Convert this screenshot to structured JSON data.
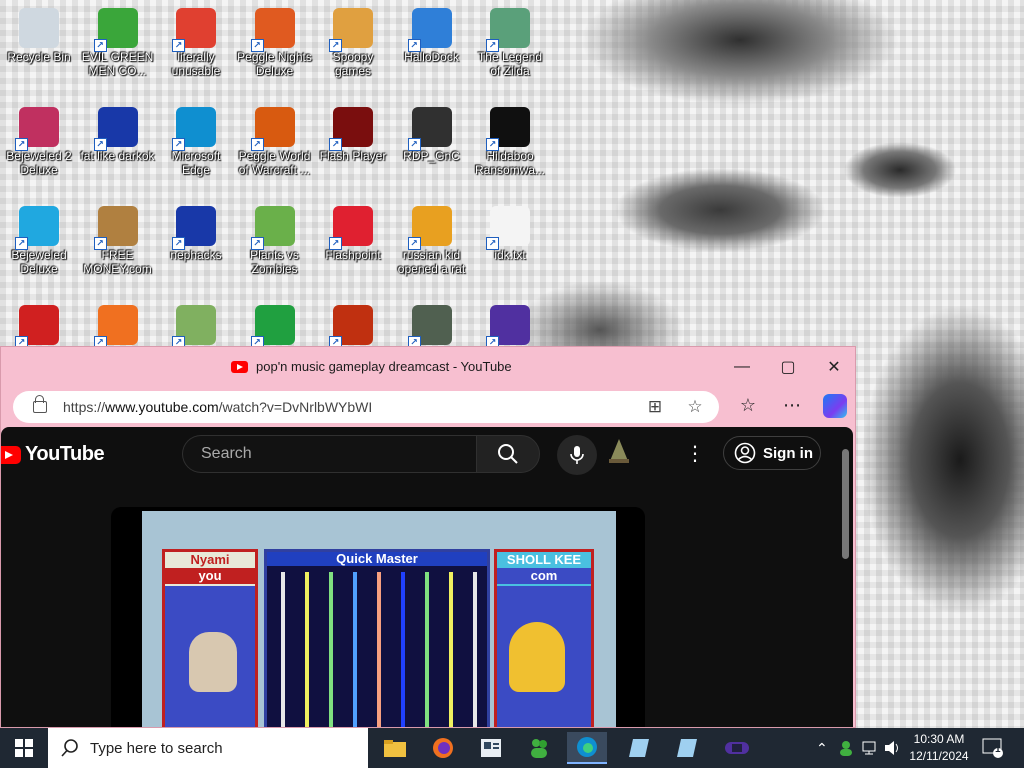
{
  "desktop": {
    "icons": [
      {
        "label": "Recycle Bin",
        "icon": "recycle-bin-icon",
        "color": "#cfd8e0"
      },
      {
        "label": "EVIL GREEN\nMEN CO...",
        "icon": "green-men-icon",
        "color": "#3aa63a"
      },
      {
        "label": "literally\nunusable",
        "icon": "chrome-icon",
        "color": "#e04030"
      },
      {
        "label": "Peggle Nights\nDeluxe",
        "icon": "peggle-icon",
        "color": "#e05a20"
      },
      {
        "label": "Spoopy\ngames",
        "icon": "folder-icon",
        "color": "#e0a040"
      },
      {
        "label": "HalloDock",
        "icon": "shield-icon",
        "color": "#2f7fd8"
      },
      {
        "label": "The Legend\nof Zilda",
        "icon": "zilda-icon",
        "color": "#5aa07a"
      },
      {
        "label": "Bejeweled 2\nDeluxe",
        "icon": "bejeweled-icon",
        "color": "#c03060"
      },
      {
        "label": "fat like darkok",
        "icon": "mpi-icon",
        "color": "#1838a8"
      },
      {
        "label": "Microsoft\nEdge",
        "icon": "edge-icon",
        "color": "#0f8fd0"
      },
      {
        "label": "Peggle World\nof Warcraft ...",
        "icon": "peggle-icon",
        "color": "#d85a10"
      },
      {
        "label": "Flash Player",
        "icon": "flash-icon",
        "color": "#7a0e0e"
      },
      {
        "label": "RDP_GnC",
        "icon": "rdp-icon",
        "color": "#303030"
      },
      {
        "label": "Hildaboo\nRansomwa...",
        "icon": "yashma-icon",
        "color": "#101010"
      },
      {
        "label": "Bejeweled\nDeluxe",
        "icon": "gem-icon",
        "color": "#20a8e0"
      },
      {
        "label": "FREE\nMONEY.com",
        "icon": "money-bag-icon",
        "color": "#b08040"
      },
      {
        "label": "nephacks",
        "icon": "mpi-icon",
        "color": "#1838a8"
      },
      {
        "label": "Plants vs\nZombies",
        "icon": "plant-icon",
        "color": "#6ab04a"
      },
      {
        "label": "Flashpoint",
        "icon": "flashpoint-icon",
        "color": "#e02030"
      },
      {
        "label": "russian kid\nopened a rat",
        "icon": "de-icon",
        "color": "#e8a020"
      },
      {
        "label": "idk.txt",
        "icon": "text-file-icon",
        "color": "#f4f4f4"
      },
      {
        "label": "",
        "icon": "red-fuzzy-icon",
        "color": "#d02020"
      },
      {
        "label": "",
        "icon": "firefox-icon",
        "color": "#f07020"
      },
      {
        "label": "",
        "icon": "notepad-icon",
        "color": "#80b060"
      },
      {
        "label": "",
        "icon": "green-ball-icon",
        "color": "#20a040"
      },
      {
        "label": "",
        "icon": "clock-game-icon",
        "color": "#c03010"
      },
      {
        "label": "",
        "icon": "game-badge-icon",
        "color": "#506050"
      },
      {
        "label": "",
        "icon": "gba-icon",
        "color": "#5030a0"
      }
    ]
  },
  "browser": {
    "tab_title": "pop'n music gameplay dreamcast - YouTube",
    "url_prefix": "https://",
    "url_host": "www.youtube.com",
    "url_path": "/watch?v=DvNrlbWYbWI",
    "accent": "#f7bfd0"
  },
  "youtube": {
    "logo_text": "YouTube",
    "search_placeholder": "Search",
    "sign_in": "Sign in"
  },
  "game": {
    "left_name": "Nyami",
    "left_sub": "you",
    "center_title": "Quick Master",
    "right_name": "SHOLL KEE",
    "right_sub": "com"
  },
  "taskbar": {
    "search_placeholder": "Type here to search",
    "time": "10:30 AM",
    "date": "12/11/2024",
    "notification_count": "1",
    "apps": [
      "file-explorer-icon",
      "firefox-icon",
      "news-icon",
      "green-men-icon",
      "edge-icon",
      "notepad-icon",
      "notepad-icon",
      "gba-icon"
    ]
  }
}
